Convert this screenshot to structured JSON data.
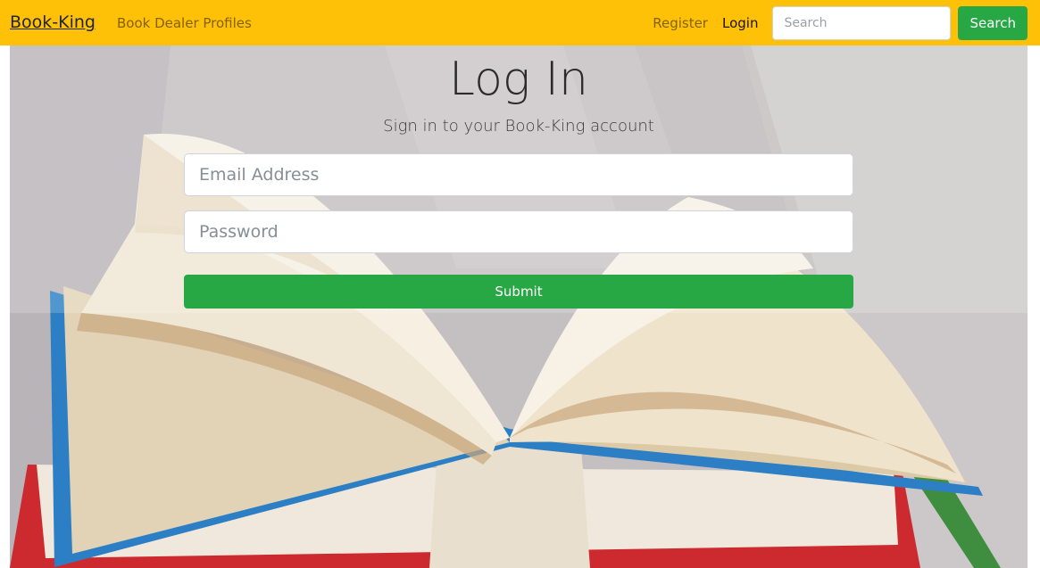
{
  "navbar": {
    "brand": "Book-King",
    "links": {
      "book_dealer_profiles": "Book Dealer Profiles",
      "register": "Register",
      "login": "Login"
    },
    "search": {
      "placeholder": "Search",
      "button_label": "Search"
    }
  },
  "login": {
    "title": "Log In",
    "subtitle": "Sign in to your Book-King account",
    "email_placeholder": "Email Address",
    "password_placeholder": "Password",
    "submit_label": "Submit"
  },
  "colors": {
    "navbar_bg": "#ffc107",
    "primary_action": "#28a745"
  }
}
